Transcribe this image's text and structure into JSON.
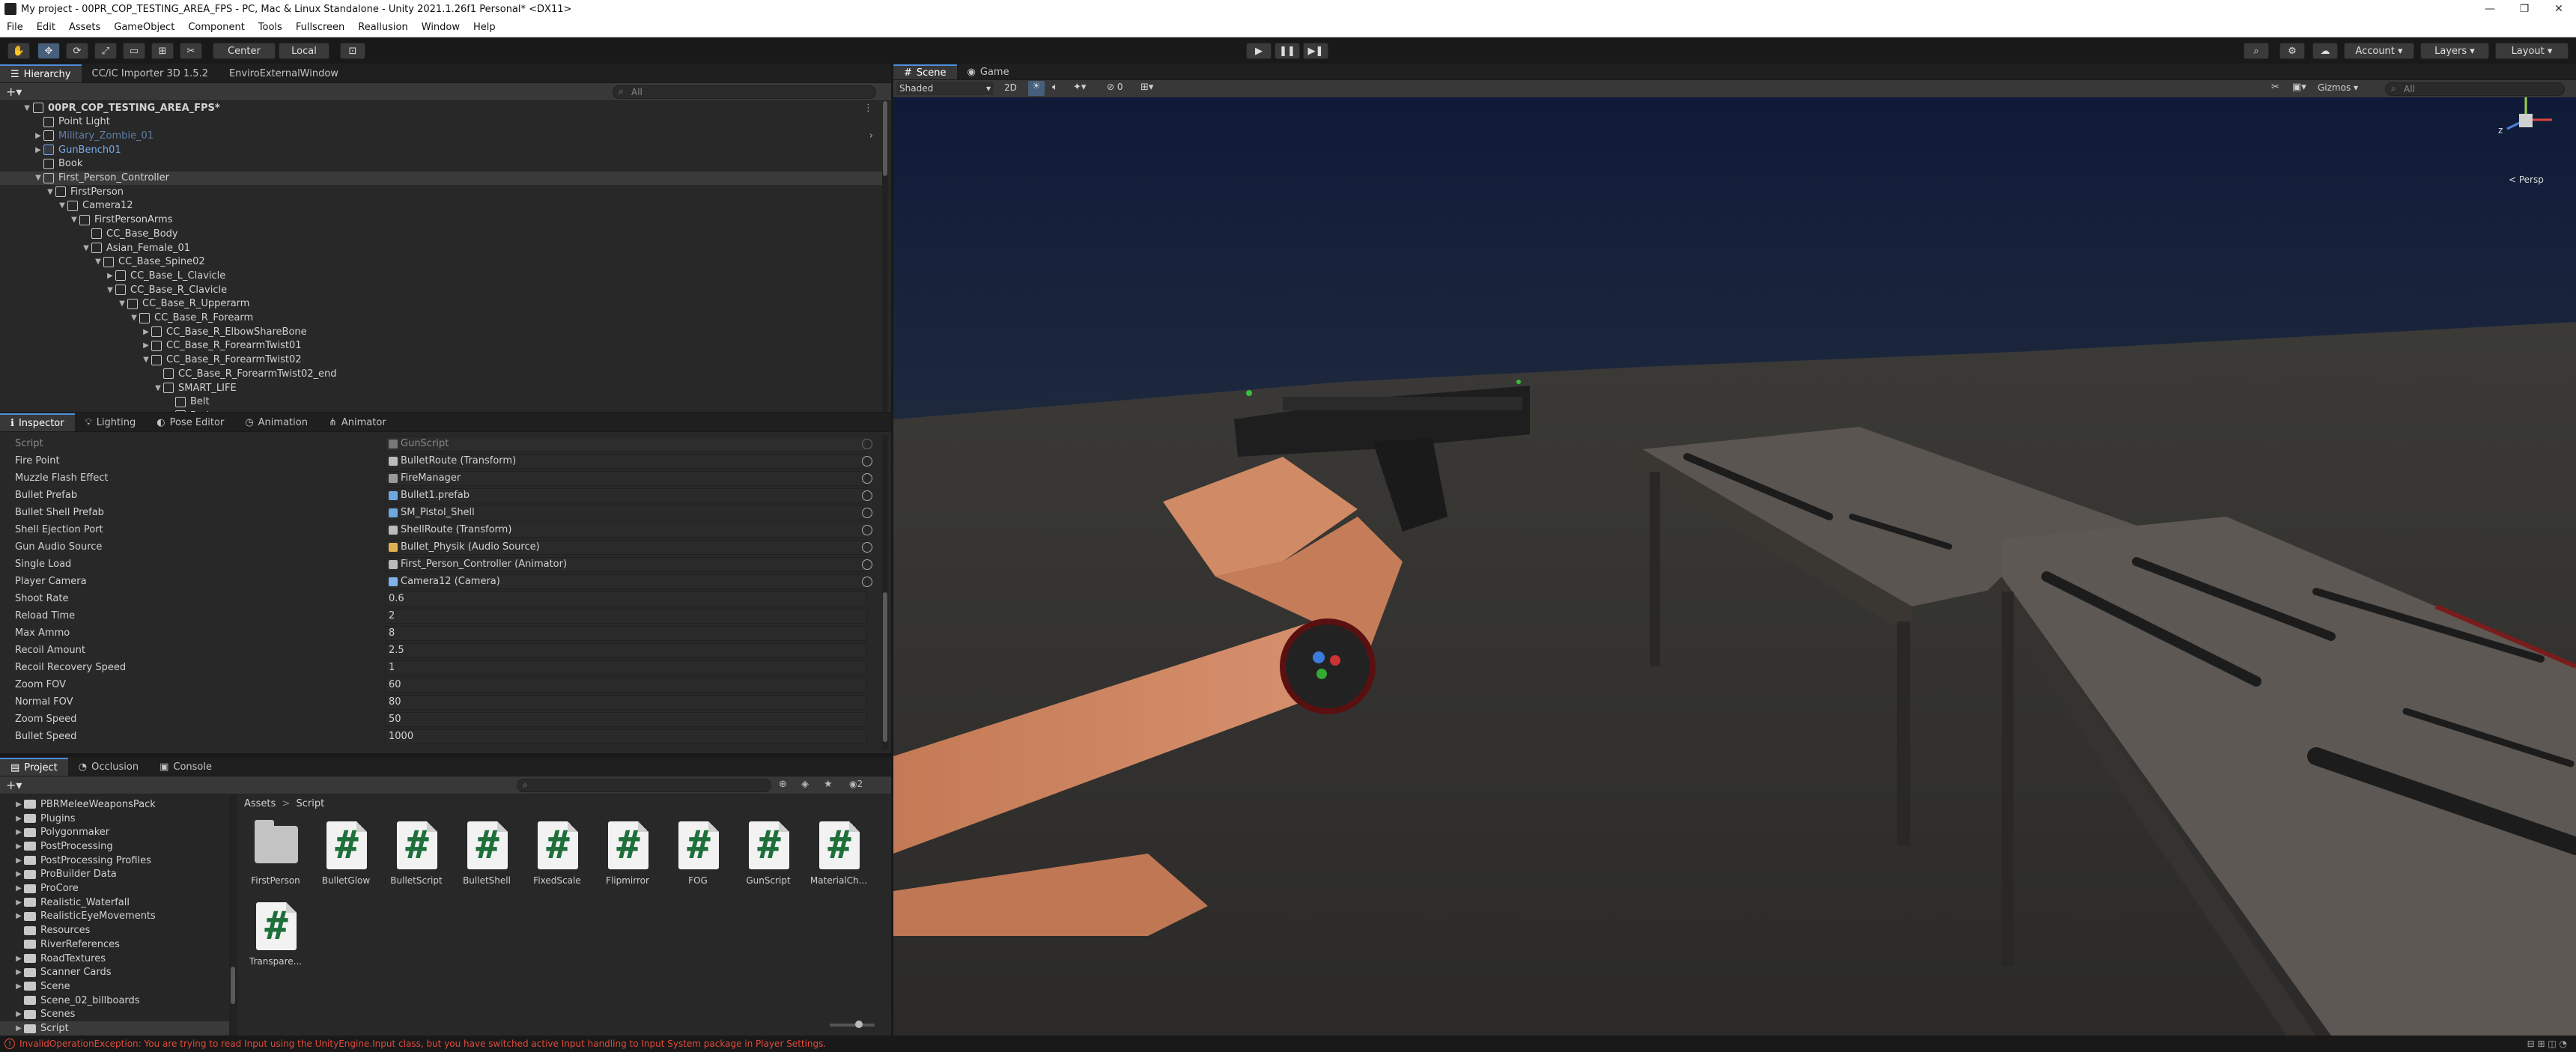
{
  "window": {
    "title": "My project - 00PR_COP_TESTING_AREA_FPS - PC, Mac & Linux Standalone - Unity 2021.1.26f1 Personal* <DX11>",
    "minimize": "—",
    "maximize": "❐",
    "close": "✕"
  },
  "menu": [
    "File",
    "Edit",
    "Assets",
    "GameObject",
    "Component",
    "Tools",
    "Fullscreen",
    "Reallusion",
    "Window",
    "Help"
  ],
  "toolbar": {
    "center_label": "Center",
    "local_label": "Local",
    "account_label": "Account",
    "layers_label": "Layers",
    "layout_label": "Layout"
  },
  "hierarchy": {
    "tabs": [
      "Hierarchy",
      "CC/iC Importer 3D 1.5.2",
      "EnviroExternalWindow"
    ],
    "search_placeholder": "All",
    "scene_name": "00PR_COP_TESTING_AREA_FPS*",
    "items": [
      {
        "label": "Point Light",
        "depth": 1,
        "arrow": "",
        "kind": "normal"
      },
      {
        "label": "Military_Zombie_01",
        "depth": 1,
        "arrow": "▶",
        "kind": "faded"
      },
      {
        "label": "GunBench01",
        "depth": 1,
        "arrow": "▶",
        "kind": "prefab"
      },
      {
        "label": "Book",
        "depth": 1,
        "arrow": "",
        "kind": "normal"
      },
      {
        "label": "First_Person_Controller",
        "depth": 1,
        "arrow": "▼",
        "kind": "highlight"
      },
      {
        "label": "FirstPerson",
        "depth": 2,
        "arrow": "▼",
        "kind": "normal"
      },
      {
        "label": "Camera12",
        "depth": 3,
        "arrow": "▼",
        "kind": "normal"
      },
      {
        "label": "FirstPersonArms",
        "depth": 4,
        "arrow": "▼",
        "kind": "normal"
      },
      {
        "label": "CC_Base_Body",
        "depth": 5,
        "arrow": "",
        "kind": "normal"
      },
      {
        "label": "Asian_Female_01",
        "depth": 5,
        "arrow": "▼",
        "kind": "normal"
      },
      {
        "label": "CC_Base_Spine02",
        "depth": 6,
        "arrow": "▼",
        "kind": "normal"
      },
      {
        "label": "CC_Base_L_Clavicle",
        "depth": 7,
        "arrow": "▶",
        "kind": "normal"
      },
      {
        "label": "CC_Base_R_Clavicle",
        "depth": 7,
        "arrow": "▼",
        "kind": "normal"
      },
      {
        "label": "CC_Base_R_Upperarm",
        "depth": 8,
        "arrow": "▼",
        "kind": "normal"
      },
      {
        "label": "CC_Base_R_Forearm",
        "depth": 9,
        "arrow": "▼",
        "kind": "normal"
      },
      {
        "label": "CC_Base_R_ElbowShareBone",
        "depth": 10,
        "arrow": "▶",
        "kind": "normal"
      },
      {
        "label": "CC_Base_R_ForearmTwist01",
        "depth": 10,
        "arrow": "▶",
        "kind": "normal"
      },
      {
        "label": "CC_Base_R_ForearmTwist02",
        "depth": 10,
        "arrow": "▼",
        "kind": "normal"
      },
      {
        "label": "CC_Base_R_ForearmTwist02_end",
        "depth": 11,
        "arrow": "",
        "kind": "normal"
      },
      {
        "label": "SMART_LIFE",
        "depth": 11,
        "arrow": "▼",
        "kind": "normal"
      },
      {
        "label": "Belt",
        "depth": 12,
        "arrow": "",
        "kind": "normal"
      },
      {
        "label": "Body",
        "depth": 12,
        "arrow": "",
        "kind": "normal"
      }
    ]
  },
  "inspector": {
    "tabs": [
      "Inspector",
      "Lighting",
      "Pose Editor",
      "Animation",
      "Animator"
    ],
    "script_label": "Script",
    "script_value": "GunScript",
    "fields": [
      {
        "label": "Fire Point",
        "value": "BulletRoute (Transform)",
        "ref": true,
        "icon": "#bbbbbb"
      },
      {
        "label": "Muzzle Flash Effect",
        "value": "FireManager",
        "ref": true,
        "icon": "#9a9a9a"
      },
      {
        "label": "Bullet Prefab",
        "value": "Bullet1.prefab",
        "ref": true,
        "icon": "#6ea8e0"
      },
      {
        "label": "Bullet Shell Prefab",
        "value": "SM_Pistol_Shell",
        "ref": true,
        "icon": "#6ea8e0"
      },
      {
        "label": "Shell Ejection Port",
        "value": "ShellRoute (Transform)",
        "ref": true,
        "icon": "#bbbbbb"
      },
      {
        "label": "Gun Audio Source",
        "value": "Bullet_Physik (Audio Source)",
        "ref": true,
        "icon": "#e0b050"
      },
      {
        "label": "Single Load",
        "value": "First_Person_Controller (Animator)",
        "ref": true,
        "icon": "#bbbbbb"
      },
      {
        "label": "Player Camera",
        "value": "Camera12 (Camera)",
        "ref": true,
        "icon": "#7fb2e8"
      },
      {
        "label": "Shoot Rate",
        "value": "0.6",
        "ref": false
      },
      {
        "label": "Reload Time",
        "value": "2",
        "ref": false
      },
      {
        "label": "Max Ammo",
        "value": "8",
        "ref": false
      },
      {
        "label": "Recoil Amount",
        "value": "2.5",
        "ref": false
      },
      {
        "label": "Recoil Recovery Speed",
        "value": "1",
        "ref": false
      },
      {
        "label": "Zoom FOV",
        "value": "60",
        "ref": false
      },
      {
        "label": "Normal FOV",
        "value": "80",
        "ref": false
      },
      {
        "label": "Zoom Speed",
        "value": "50",
        "ref": false
      },
      {
        "label": "Bullet Speed",
        "value": "1000",
        "ref": false
      }
    ]
  },
  "project": {
    "tabs": [
      "Project",
      "Occlusion",
      "Console"
    ],
    "breadcrumb_root": "Assets",
    "breadcrumb_sep": ">",
    "breadcrumb_current": "Script",
    "badge_count": "2",
    "folders": [
      {
        "label": "PBRMeleeWeaponsPack",
        "arrow": "▶"
      },
      {
        "label": "Plugins",
        "arrow": "▶"
      },
      {
        "label": "Polygonmaker",
        "arrow": "▶"
      },
      {
        "label": "PostProcessing",
        "arrow": "▶"
      },
      {
        "label": "PostProcessing Profiles",
        "arrow": "▶"
      },
      {
        "label": "ProBuilder Data",
        "arrow": "▶"
      },
      {
        "label": "ProCore",
        "arrow": "▶"
      },
      {
        "label": "Realistic_Waterfall",
        "arrow": "▶"
      },
      {
        "label": "RealisticEyeMovements",
        "arrow": "▶"
      },
      {
        "label": "Resources",
        "arrow": ""
      },
      {
        "label": "RiverReferences",
        "arrow": ""
      },
      {
        "label": "RoadTextures",
        "arrow": "▶"
      },
      {
        "label": "Scanner Cards",
        "arrow": "▶"
      },
      {
        "label": "Scene",
        "arrow": "▶"
      },
      {
        "label": "Scene_02_billboards",
        "arrow": ""
      },
      {
        "label": "Scenes",
        "arrow": "▶"
      },
      {
        "label": "Script",
        "arrow": "▶"
      }
    ],
    "assets": [
      {
        "label": "FirstPerson",
        "kind": "folder"
      },
      {
        "label": "BulletGlow",
        "kind": "script"
      },
      {
        "label": "BulletScript",
        "kind": "script"
      },
      {
        "label": "BulletShell",
        "kind": "script"
      },
      {
        "label": "FixedScale",
        "kind": "script"
      },
      {
        "label": "Flipmirror",
        "kind": "script"
      },
      {
        "label": "FOG",
        "kind": "script"
      },
      {
        "label": "GunScript",
        "kind": "script"
      },
      {
        "label": "MaterialCh...",
        "kind": "script"
      },
      {
        "label": "Transpare...",
        "kind": "script"
      }
    ]
  },
  "scene": {
    "tabs": [
      "Scene",
      "Game"
    ],
    "shading_mode": "Shaded",
    "mode_2d": "2D",
    "hidden_count": "0",
    "gizmos_label": "Gizmos",
    "search_placeholder": "All",
    "persp_label": "< Persp"
  },
  "status": {
    "message": "InvalidOperationException: You are trying to read Input using the UnityEngine.Input class, but you have switched active Input handling to Input System package in Player Settings."
  },
  "colors": {
    "accent": "#4d8fd9",
    "error": "#e04b3c",
    "panel_bg": "#282828",
    "prefab_blue": "#7aa9e6"
  }
}
